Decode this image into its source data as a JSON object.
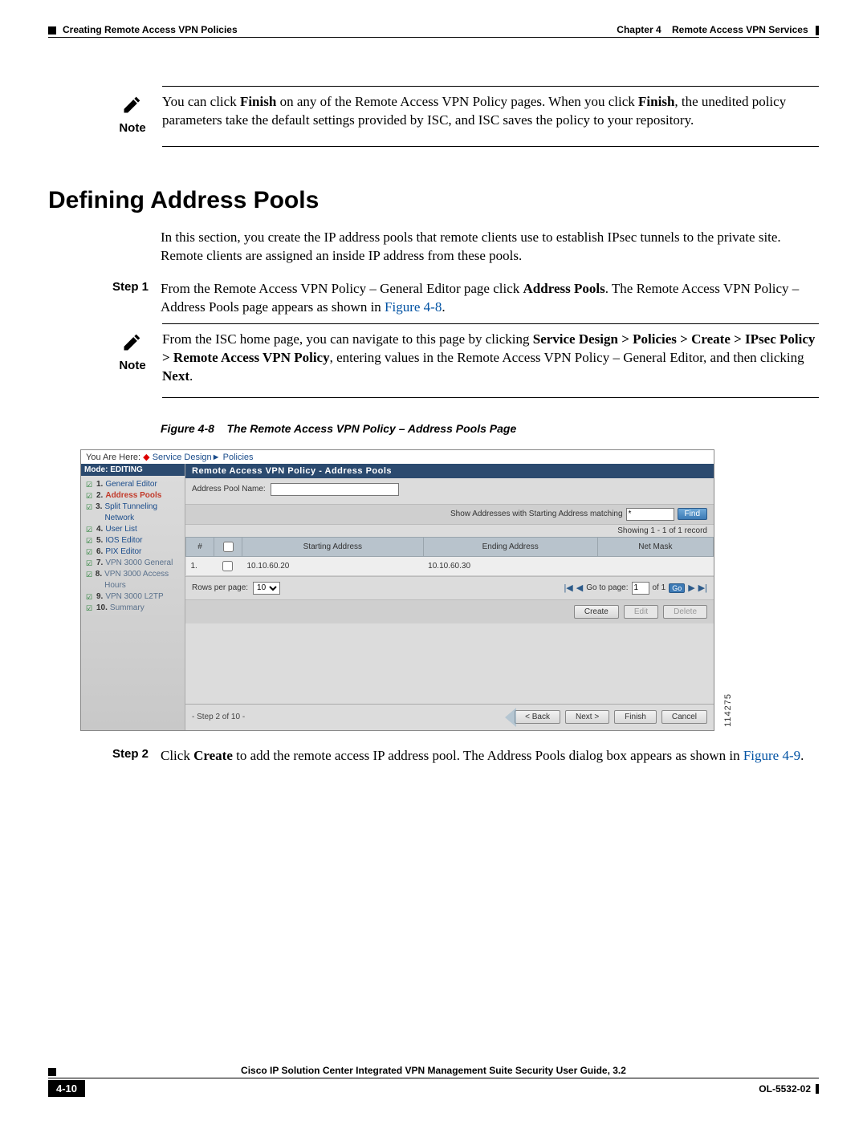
{
  "header": {
    "left": "Creating Remote Access VPN Policies",
    "right_prefix": "Chapter 4",
    "right_title": "Remote Access VPN Services"
  },
  "note1": {
    "label": "Note",
    "text_pre": "You can click ",
    "finish1": "Finish",
    "text_mid": " on any of the Remote Access VPN Policy pages. When you click ",
    "finish2": "Finish",
    "text_post": ", the unedited policy parameters take the default settings provided by ISC, and ISC saves the policy to your repository."
  },
  "section_heading": "Defining Address Pools",
  "intro": "In this section, you create the IP address pools that remote clients use to establish IPsec tunnels to the private site. Remote clients are assigned an inside IP address from these pools.",
  "step1": {
    "label": "Step 1",
    "t1": "From the Remote Access VPN Policy – General Editor page click ",
    "bold1": "Address Pools",
    "t2": ". The Remote Access VPN Policy – Address Pools page appears as shown in ",
    "link": "Figure 4-8",
    "t3": "."
  },
  "note2": {
    "label": "Note",
    "t1": "From the ISC home page, you can navigate to this page by clicking ",
    "bold1": "Service Design > Policies > Create > IPsec Policy > Remote Access VPN Policy",
    "t2": ", entering values in the Remote Access VPN Policy – General Editor, and then clicking ",
    "bold2": "Next",
    "t3": "."
  },
  "figcaption": {
    "num": "Figure 4-8",
    "title": "The Remote Access VPN Policy – Address Pools Page"
  },
  "screenshot": {
    "breadcrumb": {
      "prefix": "You Are Here:",
      "l1": "Service Design",
      "l2": "Policies"
    },
    "mode": "Mode: EDITING",
    "sidebar": [
      {
        "num": "1.",
        "label": "General Editor",
        "cls": "link"
      },
      {
        "num": "2.",
        "label": "Address Pools",
        "cls": "active"
      },
      {
        "num": "3.",
        "label": "Split Tunneling Network",
        "cls": "link"
      },
      {
        "num": "4.",
        "label": "User List",
        "cls": "link"
      },
      {
        "num": "5.",
        "label": "IOS Editor",
        "cls": "link"
      },
      {
        "num": "6.",
        "label": "PIX Editor",
        "cls": "link"
      },
      {
        "num": "7.",
        "label": "VPN 3000 General",
        "cls": "inactive"
      },
      {
        "num": "8.",
        "label": "VPN 3000 Access Hours",
        "cls": "inactive"
      },
      {
        "num": "9.",
        "label": "VPN 3000 L2TP",
        "cls": "inactive"
      },
      {
        "num": "10.",
        "label": "Summary",
        "cls": "inactive"
      }
    ],
    "main_title": "Remote Access VPN Policy - Address Pools",
    "pool_name_label": "Address Pool Name:",
    "filter_label": "Show Addresses with Starting Address matching",
    "filter_val": "*",
    "find": "Find",
    "records": "Showing 1 - 1 of 1 record",
    "cols": {
      "idx": "#",
      "start": "Starting Address",
      "end": "Ending Address",
      "mask": "Net Mask"
    },
    "row": {
      "idx": "1.",
      "start": "10.10.60.20",
      "end": "10.10.60.30",
      "mask": ""
    },
    "rows_per_page": "Rows per page:",
    "rpp_val": "10",
    "goto": "Go to page:",
    "goto_val": "1",
    "goto_of": "of 1",
    "go": "Go",
    "actions": {
      "create": "Create",
      "edit": "Edit",
      "delete": "Delete"
    },
    "wizard_step": "- Step 2 of 10 -",
    "nav": {
      "back": "< Back",
      "next": "Next >",
      "finish": "Finish",
      "cancel": "Cancel"
    },
    "ref": "114275"
  },
  "step2": {
    "label": "Step 2",
    "t1": "Click ",
    "bold1": "Create",
    "t2": " to add the remote access IP address pool. The Address Pools dialog box appears as shown in ",
    "link": "Figure 4-9",
    "t3": "."
  },
  "footer": {
    "doc_title": "Cisco IP Solution Center Integrated VPN Management Suite Security User Guide, 3.2",
    "page": "4-10",
    "doc_num": "OL-5532-02"
  }
}
